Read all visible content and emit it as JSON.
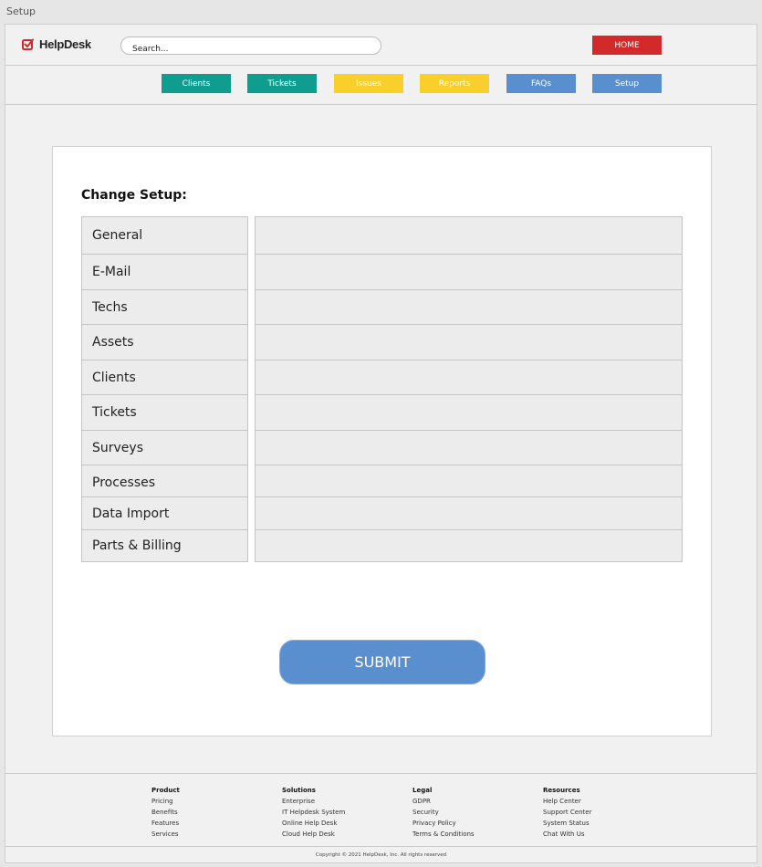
{
  "window": {
    "title": "Setup"
  },
  "header": {
    "logo_text": "HelpDesk",
    "search_placeholder": "Search...",
    "home_label": "HOME"
  },
  "nav": [
    {
      "label": "Clients",
      "color": "#0e9d8f"
    },
    {
      "label": "Tickets",
      "color": "#0e9d8f"
    },
    {
      "label": "Issues",
      "color": "#f9cf2b"
    },
    {
      "label": "Reports",
      "color": "#f9cf2b"
    },
    {
      "label": "FAQs",
      "color": "#5a8fcf"
    },
    {
      "label": "Setup",
      "color": "#5a8fcf"
    }
  ],
  "main": {
    "title": "Change Setup:",
    "rows": [
      {
        "label": "General",
        "value": ""
      },
      {
        "label": "E-Mail",
        "value": ""
      },
      {
        "label": "Techs",
        "value": ""
      },
      {
        "label": "Assets",
        "value": ""
      },
      {
        "label": "Clients",
        "value": ""
      },
      {
        "label": "Tickets",
        "value": ""
      },
      {
        "label": "Surveys",
        "value": ""
      },
      {
        "label": "Processes",
        "value": ""
      },
      {
        "label": "Data Import",
        "value": ""
      },
      {
        "label": "Parts & Billing",
        "value": ""
      }
    ],
    "submit_label": "SUBMIT"
  },
  "footer": {
    "columns": [
      {
        "heading": "Product",
        "links": [
          "Pricing",
          "Benefits",
          "Features",
          "Services"
        ]
      },
      {
        "heading": "Solutions",
        "links": [
          "Enterprise",
          "IT Helpdesk System",
          "Online Help Desk",
          "Cloud Help Desk"
        ]
      },
      {
        "heading": "Legal",
        "links": [
          "GDPR",
          "Security",
          "Privacy Policy",
          "Terms & Conditions"
        ]
      },
      {
        "heading": "Resources",
        "links": [
          "Help Center",
          "Support Center",
          "System Status",
          "Chat With Us"
        ]
      }
    ],
    "copyright": "Copyright © 2021 HelpDesk, Inc. All rights reserved"
  },
  "colors": {
    "brand_red": "#d22a2a",
    "teal": "#0e9d8f",
    "yellow": "#f9cf2b",
    "blue": "#5a8fcf"
  },
  "icons": {
    "logo": "check-square-icon"
  }
}
